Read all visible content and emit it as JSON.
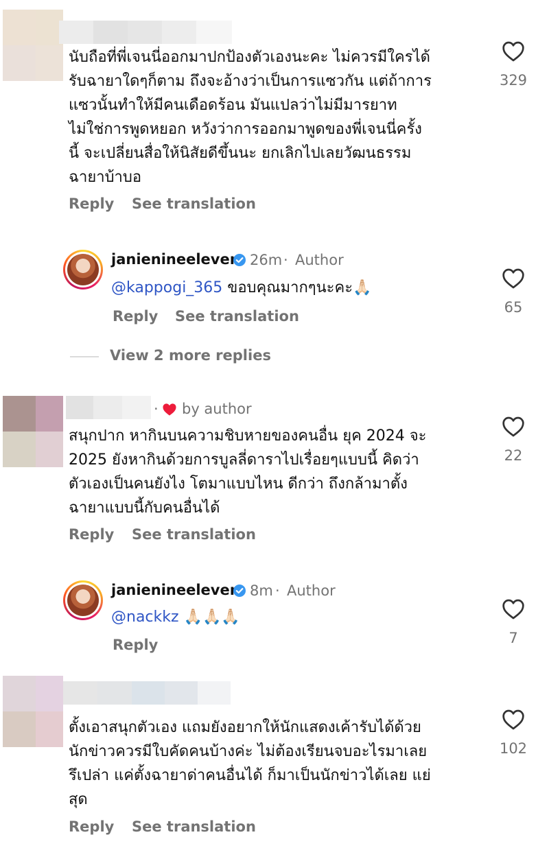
{
  "comments": [
    {
      "lines": [
        "นับถือที่พี่เจนนี่ออกมาปกป้องตัวเองนะคะ ไม่ควรมีใครได้",
        "รับฉายาใดๆก็ตาม ถึงจะอ้างว่าเป็นการแซวกัน แต่ถ้าการ",
        "แซวนั้นทำให้มีคนเดือดร้อน มันแปลว่าไม่มีมารยาท",
        "ไม่ใช่การพูดหยอก หวังว่าการออกมาพูดของพี่เจนนี่ครั้ง",
        "นี้ จะเปลี่ยนสื่อให้นิสัยดีขึ้นนะ ยกเลิกไปเลยวัฒนธรรม",
        "ฉายาบ้าบอ"
      ],
      "reply_label": "Reply",
      "translate_label": "See translation",
      "likes": "329"
    },
    {
      "lines": [
        "สนุกปาก หากินบนความชิบหายของคนอื่น ยุค 2024 จะ",
        "2025 ยังหากินด้วยการบูลลี่ดาราไปเรื่อยๆแบบนี้ คิดว่า",
        "ตัวเองเป็นคนยังไง โตมาแบบไหน ดีกว่า ถึงกล้ามาตั้ง",
        "ฉายาแบบนี้กับคนอื่นได้"
      ],
      "liked_by": "by author",
      "reply_label": "Reply",
      "translate_label": "See translation",
      "likes": "22"
    },
    {
      "lines": [
        "ตั้งเอาสนุกตัวเอง แถมยังอยากให้นักแสดงเค้ารับได้ด้วย",
        "นักข่าวควรมีใบคัดคนบ้างค่ะ ไม่ต้องเรียนจบอะไรมาเลย",
        "รึเปล่า แค่ตั้งฉายาด่าคนอื่นได้ ก็มาเป็นนักข่าวได้เลย แย่",
        "สุด"
      ],
      "reply_label": "Reply",
      "translate_label": "See translation",
      "likes": "102"
    }
  ],
  "replies": [
    {
      "username": "janienineeleven",
      "time": "26m",
      "role": "Author",
      "mention": "@kappogi_365",
      "text": " ขอบคุณมากๆนะคะ🙏🏻",
      "reply_label": "Reply",
      "translate_label": "See translation",
      "likes": "65"
    },
    {
      "username": "janienineeleven",
      "time": "8m",
      "role": "Author",
      "mention": "@nackkz",
      "text": " 🙏🏻🙏🏻🙏🏻",
      "reply_label": "Reply",
      "likes": "7"
    }
  ],
  "view_more": "View 2 more replies",
  "colors": {
    "mention": "#2f56c5",
    "heart_red": "#ed1c3b",
    "muted": "#737373",
    "verified": "#3897f0"
  }
}
